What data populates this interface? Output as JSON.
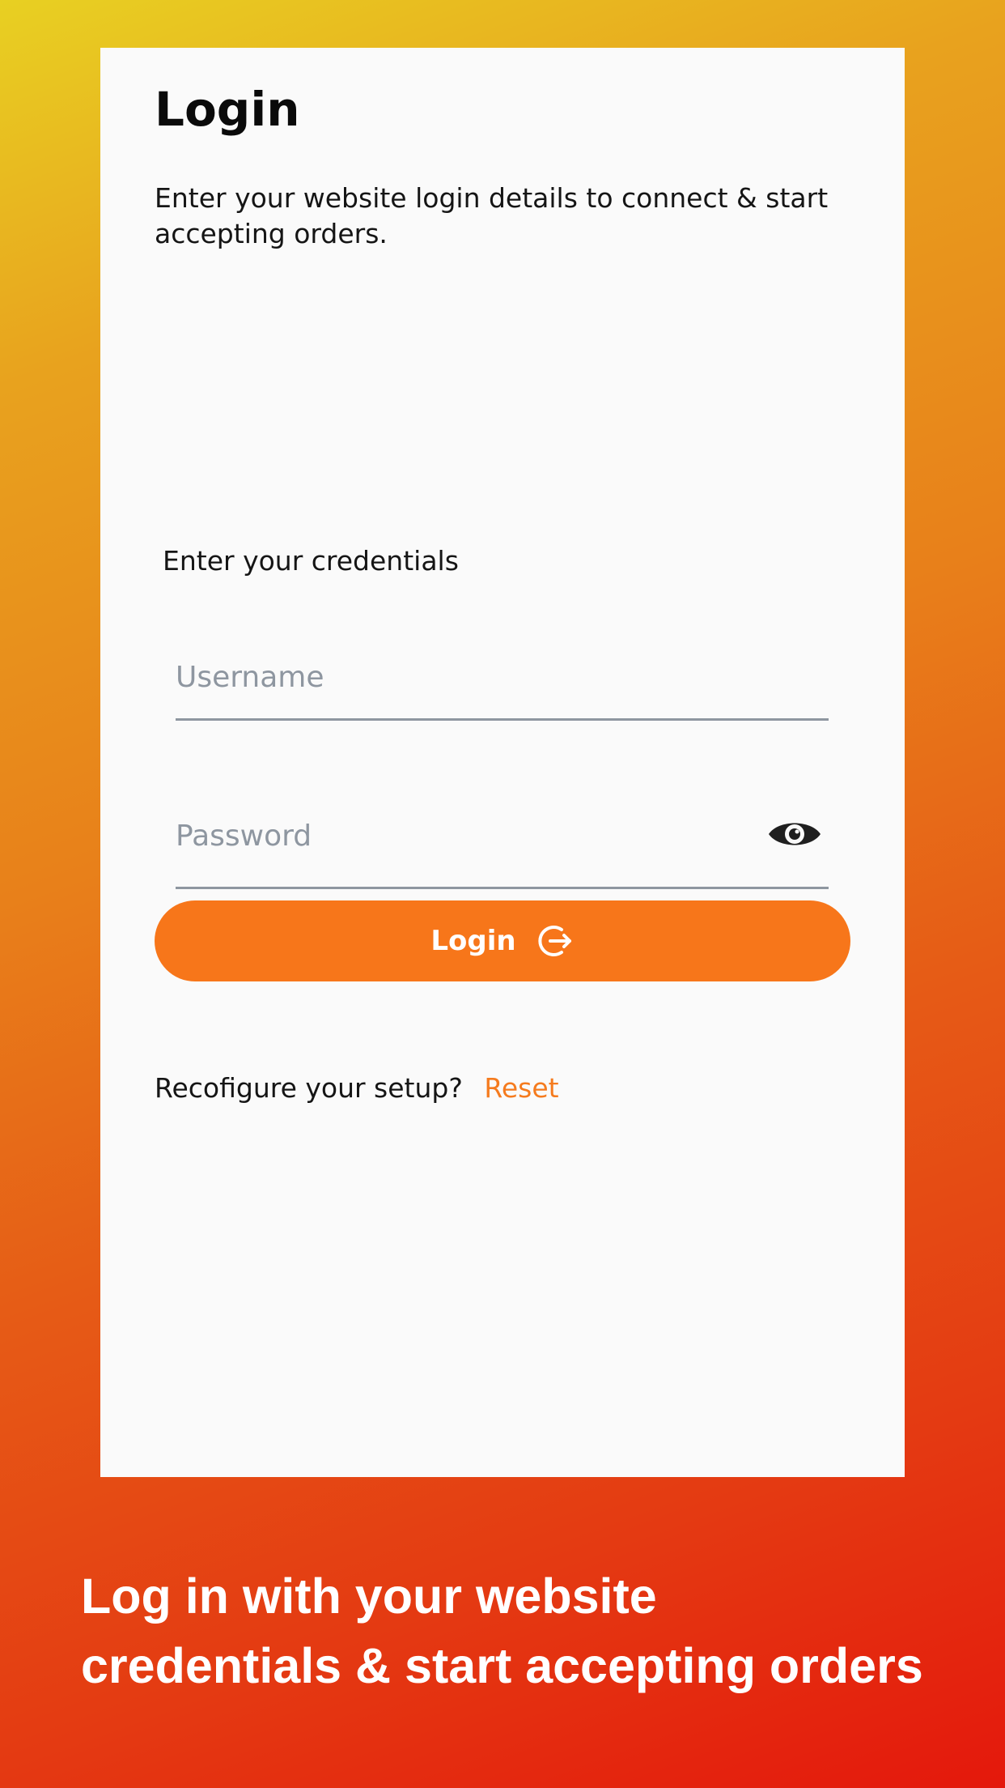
{
  "colors": {
    "accent": "#f7761a",
    "link": "#f57b1e",
    "card_background": "#fafafa",
    "gradient_start": "#e8d022",
    "gradient_end": "#e4180c"
  },
  "login_screen": {
    "title": "Login",
    "subtitle": "Enter your website login details to connect & start accepting orders.",
    "credentials_label": "Enter your credentials",
    "username": {
      "placeholder": "Username",
      "value": ""
    },
    "password": {
      "placeholder": "Password",
      "value": "",
      "toggle_icon": "eye-icon"
    },
    "login_button": {
      "label": "Login",
      "icon": "logout-arrow-icon"
    },
    "reset_prompt": "Recofigure your setup?",
    "reset_link": "Reset"
  },
  "caption": {
    "line1": "Log in with your website",
    "line2": "credentials & start accepting orders"
  }
}
